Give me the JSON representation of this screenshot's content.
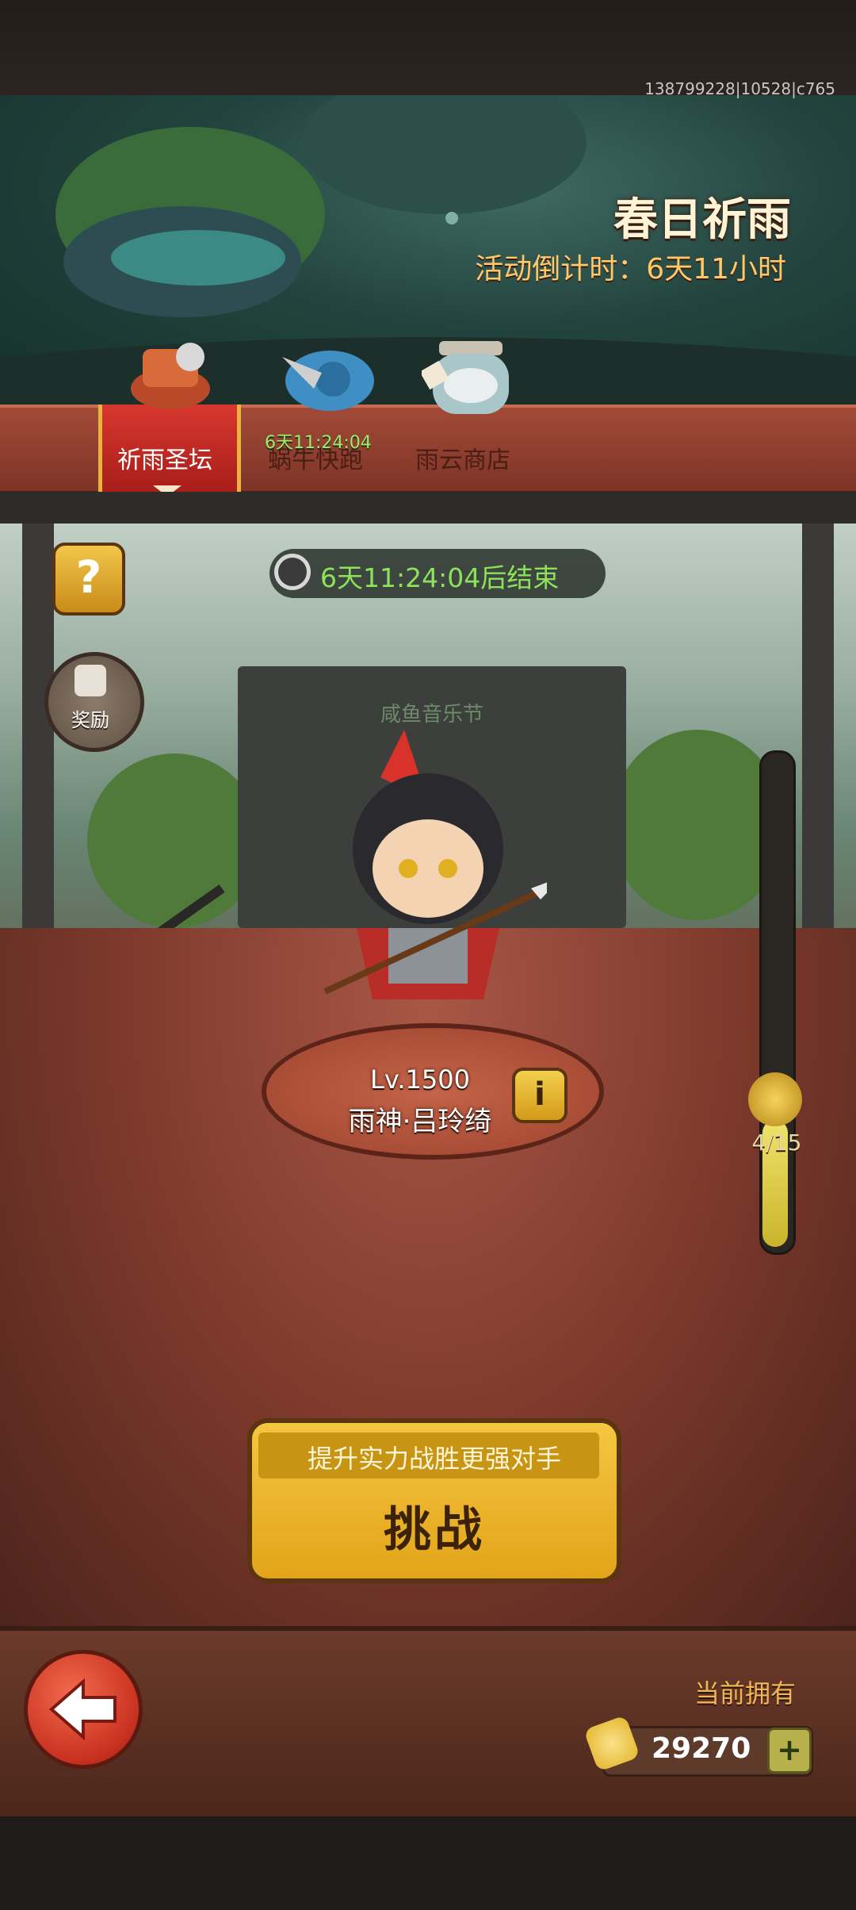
{
  "debug_info": "138799228|10528|c765",
  "event": {
    "title": "春日祈雨",
    "countdown": "活动倒计时：6天11小时"
  },
  "tabs": [
    {
      "label": "祈雨圣坛",
      "active": true
    },
    {
      "label": "蜗牛快跑",
      "timer": "6天11:24:04"
    },
    {
      "label": "雨云商店"
    }
  ],
  "stage": {
    "timer_text": "6天11:24:04后结束",
    "backdrop_title": "咸鱼音乐节",
    "help_label": "?",
    "reward_label": "奖励",
    "info_label": "i",
    "hero": {
      "level": "Lv.1500",
      "name": "雨神·吕玲绮"
    },
    "progress": {
      "text": "4/15",
      "current": 4,
      "max": 15
    }
  },
  "challenge": {
    "subtitle": "提升实力战胜更强对手",
    "label": "挑战"
  },
  "footer": {
    "currency_label": "当前拥有",
    "currency_value": "29270",
    "plus_label": "+"
  },
  "colors": {
    "accent_gold": "#f2c640",
    "tab_active": "#d8372e",
    "timer_green": "#8de25a",
    "countdown_orange": "#ffc86b"
  }
}
